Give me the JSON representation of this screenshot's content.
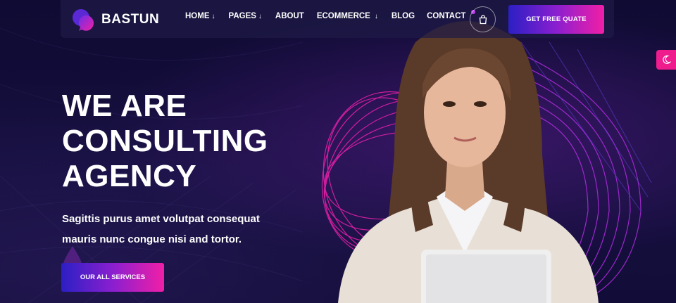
{
  "brand": {
    "name": "BASTUN",
    "logo_icon": "chat-bubbles-icon"
  },
  "nav": {
    "items": [
      {
        "label": "HOME",
        "dropdown": true
      },
      {
        "label": "PAGES",
        "dropdown": true
      },
      {
        "label": "ABOUT",
        "dropdown": false
      },
      {
        "label": "ECOMMERCE",
        "dropdown": true
      },
      {
        "label": "BLOG",
        "dropdown": false
      },
      {
        "label": "CONTACT",
        "dropdown": false
      }
    ],
    "dropdown_glyph": "↓"
  },
  "header": {
    "cart_icon": "shopping-bag-icon",
    "cta_label": "GET FREE QUATE",
    "theme_icon": "moon-icon"
  },
  "hero": {
    "headline_lines": [
      "WE ARE",
      "CONSULTING",
      "AGENCY"
    ],
    "subtext": "Sagittis purus amet volutpat consequat mauris nunc congue nisi and tortor.",
    "button_label": "OUR ALL SERVICES"
  },
  "colors": {
    "background": "#0e0a2e",
    "gradient_start": "#2b1fc4",
    "gradient_end": "#f11fa6",
    "accent_pink": "#ef1c8e"
  }
}
